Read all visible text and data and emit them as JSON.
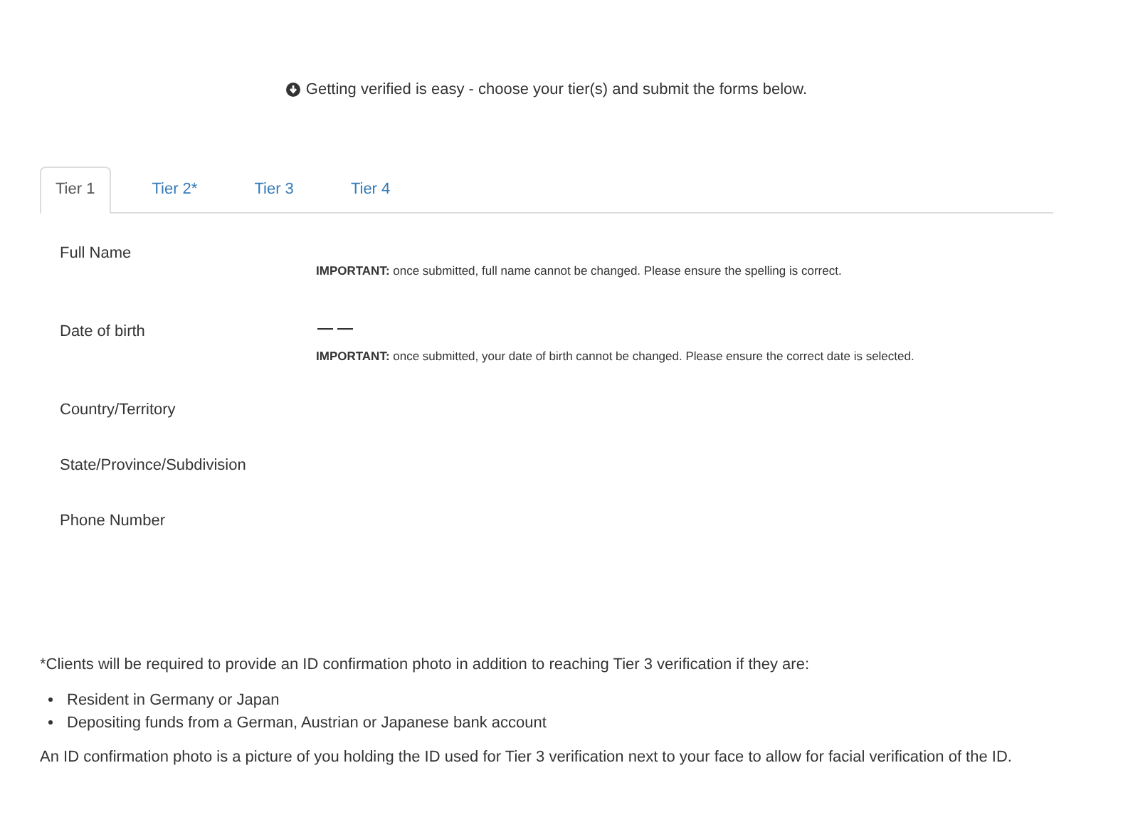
{
  "intro": "Getting verified is easy - choose your tier(s) and submit the forms below.",
  "tabs": [
    {
      "label": "Tier 1",
      "selected": true
    },
    {
      "label": "Tier 2*",
      "selected": false
    },
    {
      "label": "Tier 3",
      "selected": false
    },
    {
      "label": "Tier 4",
      "selected": false
    }
  ],
  "fields": [
    {
      "label": "Full Name",
      "note": "**IMPORTANT:** once submitted, full name cannot be changed. Please ensure the spelling is correct."
    },
    {
      "label": "Date of birth",
      "value": "— —",
      "note": "**IMPORTANT:** once submitted, your date of birth cannot be changed. Please ensure the correct date is selected."
    },
    {
      "label": "Country/Territory"
    },
    {
      "label": "State/Province/Subdivision"
    },
    {
      "label": "Phone Number"
    }
  ],
  "footnote": "*Clients will be required to provide an ID confirmation photo in addition to reaching Tier 3 verification if they are:",
  "bullets": [
    "Resident in Germany or Japan",
    "Depositing funds from a German, Austrian or Japanese bank account"
  ],
  "explanation": "An ID confirmation photo is a picture of you holding the ID used for Tier 3 verification next to your face to allow for facial verification of the ID."
}
